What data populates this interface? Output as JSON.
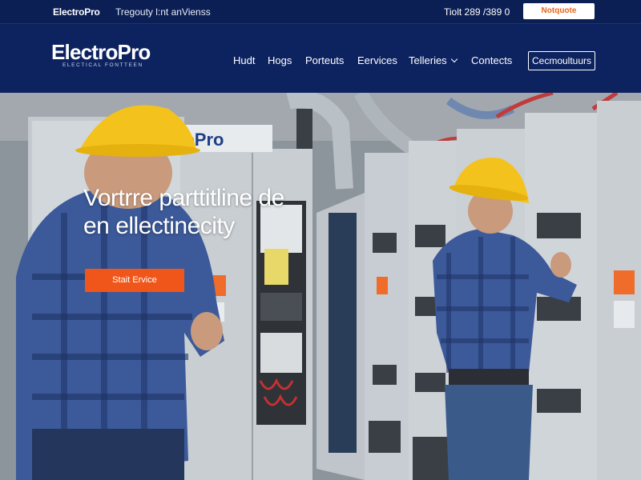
{
  "topbar": {
    "brand": "ElectroPro",
    "tagline": "Tregouty l:nt anVienss",
    "phone": "Tiolt 289 /389 0",
    "cta": "Notquote"
  },
  "header": {
    "logo_name": "ElectroPro",
    "logo_sub": "ELECTICAL FONTTEEN",
    "nav": [
      "Hudt",
      "Hogs",
      "Porteuts",
      "Eervices",
      "Telleries",
      "Contects"
    ],
    "cta": "Cecmoultuurs"
  },
  "hero": {
    "title_line1": "Vortrre parttitline de",
    "title_line2": "en ellectinecity",
    "button": "Stait Ervice",
    "panel_sign": "toPro"
  },
  "colors": {
    "navy": "#0d2360",
    "accent_orange": "#f0561a",
    "helmet_yellow": "#f4c21c",
    "shirt_blue": "#3c5a9a"
  }
}
